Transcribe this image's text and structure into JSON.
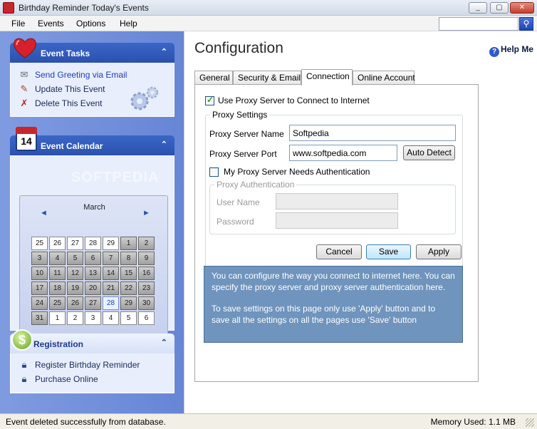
{
  "window": {
    "title": "Birthday Reminder Today's Events",
    "minimize": "_",
    "restore": "▢",
    "close": "✕"
  },
  "menu": [
    "File",
    "Events",
    "Options",
    "Help"
  ],
  "search": {
    "placeholder": "",
    "button_icon": "magnifier-icon"
  },
  "sidebar": {
    "event_tasks": {
      "title": "Event Tasks",
      "collapse": "⌃",
      "items": [
        {
          "label": "Send Greeting via Email",
          "icon": "envelope-icon"
        },
        {
          "label": "Update This Event",
          "icon": "edit-icon"
        },
        {
          "label": "Delete This Event",
          "icon": "delete-icon"
        }
      ]
    },
    "event_calendar": {
      "title": "Event Calendar",
      "collapse": "⌃",
      "icon_number": "14",
      "month": "March",
      "prev": "◄",
      "next": "►",
      "watermark": "SOFTPEDIA",
      "weeks": [
        [
          {
            "d": "25",
            "t": "other"
          },
          {
            "d": "26",
            "t": "other"
          },
          {
            "d": "27",
            "t": "other"
          },
          {
            "d": "28",
            "t": "other"
          },
          {
            "d": "29",
            "t": "other"
          },
          {
            "d": "1",
            "t": "cur"
          },
          {
            "d": "2",
            "t": "cur"
          }
        ],
        [
          {
            "d": "3",
            "t": "cur"
          },
          {
            "d": "4",
            "t": "cur"
          },
          {
            "d": "5",
            "t": "cur"
          },
          {
            "d": "6",
            "t": "cur"
          },
          {
            "d": "7",
            "t": "cur"
          },
          {
            "d": "8",
            "t": "cur"
          },
          {
            "d": "9",
            "t": "cur"
          }
        ],
        [
          {
            "d": "10",
            "t": "cur"
          },
          {
            "d": "11",
            "t": "cur"
          },
          {
            "d": "12",
            "t": "cur"
          },
          {
            "d": "13",
            "t": "cur"
          },
          {
            "d": "14",
            "t": "cur"
          },
          {
            "d": "15",
            "t": "cur"
          },
          {
            "d": "16",
            "t": "cur"
          }
        ],
        [
          {
            "d": "17",
            "t": "cur"
          },
          {
            "d": "18",
            "t": "cur"
          },
          {
            "d": "19",
            "t": "cur"
          },
          {
            "d": "20",
            "t": "cur"
          },
          {
            "d": "21",
            "t": "cur"
          },
          {
            "d": "22",
            "t": "cur"
          },
          {
            "d": "23",
            "t": "cur"
          }
        ],
        [
          {
            "d": "24",
            "t": "cur"
          },
          {
            "d": "25",
            "t": "cur"
          },
          {
            "d": "26",
            "t": "cur"
          },
          {
            "d": "27",
            "t": "cur"
          },
          {
            "d": "28",
            "t": "today"
          },
          {
            "d": "29",
            "t": "cur"
          },
          {
            "d": "30",
            "t": "cur"
          }
        ],
        [
          {
            "d": "31",
            "t": "cur"
          },
          {
            "d": "1",
            "t": "other"
          },
          {
            "d": "2",
            "t": "other"
          },
          {
            "d": "3",
            "t": "other"
          },
          {
            "d": "4",
            "t": "other"
          },
          {
            "d": "5",
            "t": "other"
          },
          {
            "d": "6",
            "t": "other"
          }
        ]
      ]
    },
    "registration": {
      "title": "Registration",
      "collapse": "⌃",
      "items": [
        {
          "label": "Register Birthday Reminder",
          "icon": "lock-icon"
        },
        {
          "label": "Purchase Online",
          "icon": "lock-icon"
        }
      ]
    }
  },
  "content": {
    "page_title": "Configuration",
    "help_label": "Help Me",
    "tabs": [
      "General",
      "Security & Email",
      "Connection",
      "Online Account"
    ],
    "active_tab": "Connection",
    "use_proxy_label": "Use Proxy Server to Connect to Internet",
    "use_proxy_checked": true,
    "proxy_settings_legend": "Proxy Settings",
    "proxy_server_name_label": "Proxy Server Name",
    "proxy_server_name_value": "Softpedia",
    "proxy_server_port_label": "Proxy Server Port",
    "proxy_server_port_value": "www.softpedia.com",
    "auto_detect_label": "Auto Detect",
    "needs_auth_label": "My Proxy Server Needs Authentication",
    "needs_auth_checked": false,
    "proxy_auth_legend": "Proxy Authentication",
    "user_name_label": "User Name",
    "user_name_value": "",
    "password_label": "Password",
    "password_value": "",
    "cancel_label": "Cancel",
    "save_label": "Save",
    "apply_label": "Apply",
    "info_p1": "You can configure the way you connect to internet here. You can specify the proxy server and proxy server authentication here.",
    "info_p2": "To save settings on this page only use 'Apply' button and to save all the settings on all the pages use 'Save' button"
  },
  "status": {
    "message": "Event deleted successfully from database.",
    "memory": "Memory Used: 1.1 MB"
  },
  "colors": {
    "sidebar_bg": "#6f8ddb",
    "panel_header": "#2f58b6",
    "info_box": "#6f94bd"
  }
}
